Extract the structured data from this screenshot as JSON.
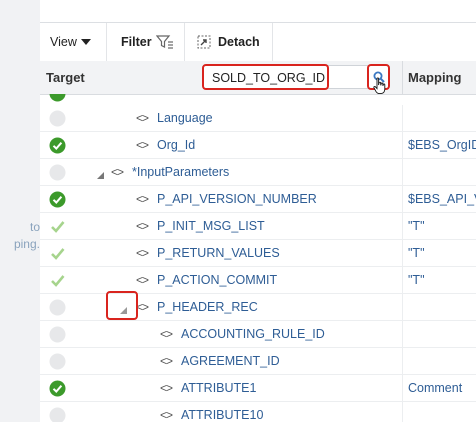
{
  "left_pane": {
    "text_line1": "to",
    "text_line2": "ping."
  },
  "toolbar": {
    "view_label": "View",
    "filter_label": "Filter",
    "detach_label": "Detach"
  },
  "header": {
    "target_label": "Target",
    "mapping_label": "Mapping",
    "search_value": "SOLD_TO_ORG_ID"
  },
  "rows": [
    {
      "status": "none",
      "name": "Language",
      "mapping": ""
    },
    {
      "status": "green-check",
      "name": "Org_Id",
      "mapping": "$EBS_OrgID"
    },
    {
      "status": "none",
      "name": "*InputParameters",
      "mapping": ""
    },
    {
      "status": "green-check",
      "name": "P_API_VERSION_NUMBER",
      "mapping": "$EBS_API_V"
    },
    {
      "status": "light-check",
      "name": "P_INIT_MSG_LIST",
      "mapping": "\"T\""
    },
    {
      "status": "light-check",
      "name": "P_RETURN_VALUES",
      "mapping": "\"T\""
    },
    {
      "status": "light-check",
      "name": "P_ACTION_COMMIT",
      "mapping": "\"T\""
    },
    {
      "status": "none",
      "name": "P_HEADER_REC",
      "mapping": ""
    },
    {
      "status": "none",
      "name": "ACCOUNTING_RULE_ID",
      "mapping": ""
    },
    {
      "status": "none",
      "name": "AGREEMENT_ID",
      "mapping": ""
    },
    {
      "status": "green-check",
      "name": "ATTRIBUTE1",
      "mapping": "Comment"
    },
    {
      "status": "none",
      "name": "ATTRIBUTE10",
      "mapping": ""
    }
  ],
  "colors": {
    "accent_blue": "#2e5d95",
    "check_green": "#3c9a2b",
    "highlight_red": "#d9241e"
  }
}
